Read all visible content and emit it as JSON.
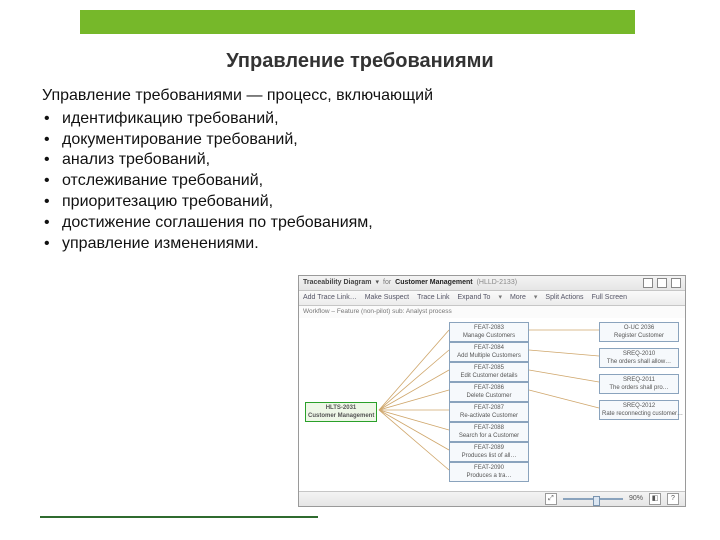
{
  "title": "Управление требованиями",
  "intro": "Управление требованиями — процесс, включающий",
  "bullets": [
    "идентификацию требований,",
    "документирование требований,",
    "анализ требований,",
    "отслеживание требований,",
    "приоритезацию требований,",
    "достижение соглашения по требованиям,",
    "управление изменениями."
  ],
  "diagram": {
    "panelTitle": {
      "label": "Traceability Diagram",
      "for": "for",
      "object": "Customer Management",
      "id": "(HLLD-2133)"
    },
    "toolbar": [
      "Add Trace Link…",
      "Make Suspect",
      "Trace Link",
      "Expand To",
      "More",
      "Split Actions",
      "Full Screen"
    ],
    "breadcrumb": "Workflow – Feature (non-pilot) sub: Analyst process",
    "root": {
      "id": "HLTS-2031",
      "name": "Customer Management"
    },
    "mid": [
      {
        "id": "FEAT-2083",
        "name": "Manage Customers"
      },
      {
        "id": "FEAT-2084",
        "name": "Add Multiple Customers"
      },
      {
        "id": "FEAT-2085",
        "name": "Edit Customer details"
      },
      {
        "id": "FEAT-2086",
        "name": "Delete Customer"
      },
      {
        "id": "FEAT-2087",
        "name": "Re-activate Customer"
      },
      {
        "id": "FEAT-2088",
        "name": "Search for a Customer"
      },
      {
        "id": "FEAT-2089",
        "name": "Produces list of all…"
      },
      {
        "id": "FEAT-2090",
        "name": "Produces a tra…"
      }
    ],
    "right": [
      {
        "id": "O-UC 2036",
        "name": "Register Customer"
      },
      {
        "id": "SREQ-2010",
        "name": "The orders shall allow…"
      },
      {
        "id": "SREQ-2011",
        "name": "The orders shall pro…"
      },
      {
        "id": "SREQ-2012",
        "name": "Rate reconnecting customer…"
      }
    ],
    "status": {
      "zoom": "90%"
    }
  }
}
